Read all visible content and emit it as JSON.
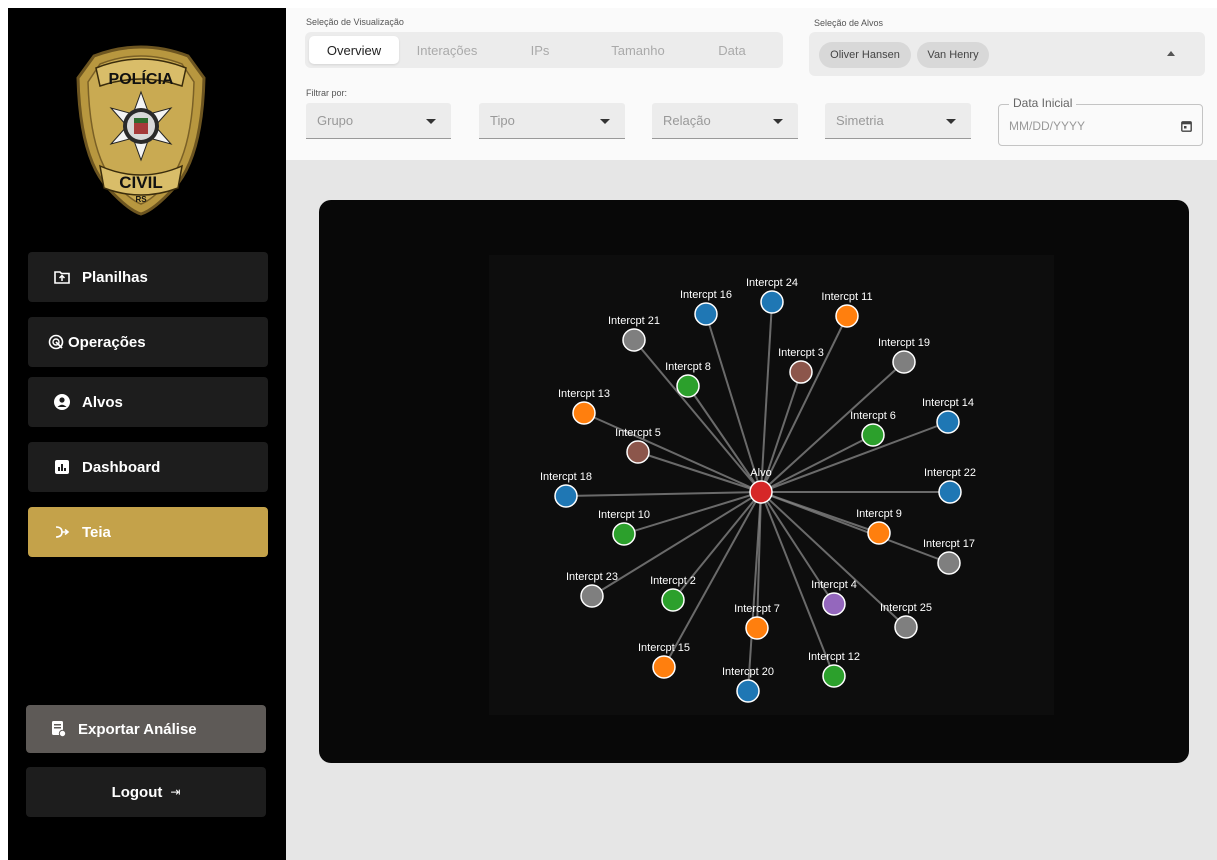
{
  "brand": {
    "badge_top_text": "POLÍCIA",
    "badge_bottom_text": "CIVIL",
    "badge_state_text": "RS",
    "colors": {
      "gold": "#c4a24a",
      "dark_gold": "#8b6f2a"
    }
  },
  "sidebar": {
    "items": [
      {
        "label": "Planilhas",
        "icon": "upload-folder-icon"
      },
      {
        "label": "Operações",
        "icon": "radar-icon"
      },
      {
        "label": "Alvos",
        "icon": "user-avatar-icon"
      },
      {
        "label": "Dashboard",
        "icon": "bar-chart-icon"
      },
      {
        "label": "Teia",
        "icon": "branching-arrow-icon",
        "active": true
      }
    ],
    "export_label": "Exportar Análise",
    "logout_label": "Logout",
    "logout_icon": "⇥"
  },
  "filters": {
    "view_selection_label": "Seleção de Visualização",
    "view_tabs": [
      "Overview",
      "Interações",
      "IPs",
      "Tamanho",
      "Data"
    ],
    "selected_view": "Overview",
    "target_selection_label": "Seleção de Alvos",
    "targets": [
      "Oliver Hansen",
      "Van Henry"
    ],
    "filter_by_label": "Filtrar por:",
    "selects": [
      "Grupo",
      "Tipo",
      "Relação",
      "Simetria"
    ],
    "date": {
      "label": "Data Inicial",
      "placeholder": "MM/DD/YYYY"
    }
  },
  "graph": {
    "center": {
      "label": "Alvo",
      "color": "#d62728"
    },
    "palette": {
      "blue": "#1f77b4",
      "orange": "#ff7f0e",
      "green": "#2ca02c",
      "gray": "#7f7f7f",
      "brown": "#8c564b",
      "purple": "#9467bd",
      "red": "#d62728"
    },
    "nodes": [
      {
        "label": "Intercpt 24",
        "color": "blue"
      },
      {
        "label": "Intercpt 16",
        "color": "blue"
      },
      {
        "label": "Intercpt 11",
        "color": "orange"
      },
      {
        "label": "Intercpt 21",
        "color": "gray"
      },
      {
        "label": "Intercpt 19",
        "color": "gray"
      },
      {
        "label": "Intercpt 3",
        "color": "brown"
      },
      {
        "label": "Intercpt 8",
        "color": "green"
      },
      {
        "label": "Intercpt 13",
        "color": "orange"
      },
      {
        "label": "Intercpt 14",
        "color": "blue"
      },
      {
        "label": "Intercpt 6",
        "color": "green"
      },
      {
        "label": "Intercpt 5",
        "color": "brown"
      },
      {
        "label": "Intercpt 18",
        "color": "blue"
      },
      {
        "label": "Intercpt 22",
        "color": "blue"
      },
      {
        "label": "Intercpt 9",
        "color": "orange"
      },
      {
        "label": "Intercpt 10",
        "color": "green"
      },
      {
        "label": "Intercpt 17",
        "color": "gray"
      },
      {
        "label": "Intercpt 23",
        "color": "gray"
      },
      {
        "label": "Intercpt 2",
        "color": "green"
      },
      {
        "label": "Intercpt 4",
        "color": "purple"
      },
      {
        "label": "Intercpt 7",
        "color": "orange"
      },
      {
        "label": "Intercpt 25",
        "color": "gray"
      },
      {
        "label": "Intercpt 15",
        "color": "orange"
      },
      {
        "label": "Intercpt 12",
        "color": "green"
      },
      {
        "label": "Intercpt 20",
        "color": "blue"
      }
    ]
  }
}
